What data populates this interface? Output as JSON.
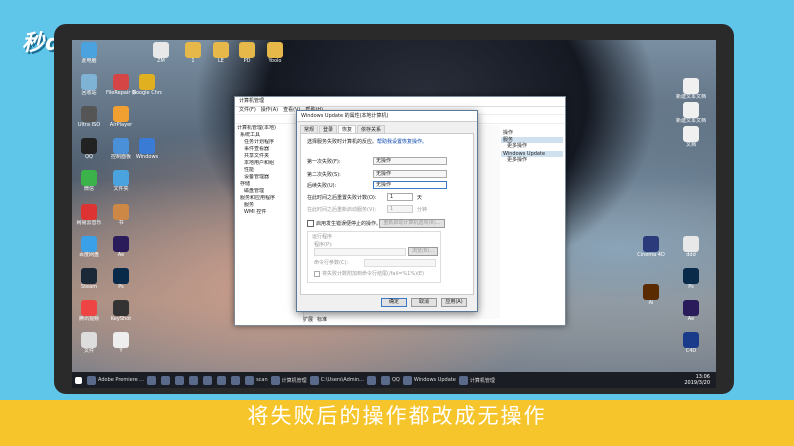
{
  "brand": "秒dòng视频",
  "caption": "将失败后的操作都改成无操作",
  "desktop_icons": [
    {
      "label": "此电脑",
      "color": "#4aa3df"
    },
    {
      "label": "ZM",
      "color": "#e8e8e8"
    },
    {
      "label": "1",
      "color": "#e6b84a"
    },
    {
      "label": "LE",
      "color": "#e6b84a"
    },
    {
      "label": "PD",
      "color": "#e6b84a"
    },
    {
      "label": "Yoolo",
      "color": "#e6b84a"
    },
    {
      "label": "回收站",
      "color": "#7fb3d5"
    },
    {
      "label": "FileRepair 数据恢复",
      "color": "#d64545"
    },
    {
      "label": "Google Chrome",
      "color": "#e0b020"
    },
    {
      "label": "Ultra ISO",
      "color": "#555"
    },
    {
      "label": "AirPlayer",
      "color": "#f0a030"
    },
    {
      "label": "QQ",
      "color": "#222"
    },
    {
      "label": "控制面板",
      "color": "#4a90d9"
    },
    {
      "label": "Windows",
      "color": "#3a7bd5"
    },
    {
      "label": "微信",
      "color": "#3cb34a"
    },
    {
      "label": "文件夹",
      "color": "#4aa3df"
    },
    {
      "label": "网易云音乐",
      "color": "#d33"
    },
    {
      "label": "书",
      "color": "#c84"
    },
    {
      "label": "百度网盘",
      "color": "#3aa0e8"
    },
    {
      "label": "Ae",
      "color": "#2a1b5a"
    },
    {
      "label": "Steam",
      "color": "#1b2838"
    },
    {
      "label": "Ps",
      "color": "#0a2a4a"
    },
    {
      "label": "腾讯视频",
      "color": "#e44"
    },
    {
      "label": "KeyShot",
      "color": "#333"
    },
    {
      "label": "文件",
      "color": "#ddd"
    },
    {
      "label": "Y",
      "color": "#eee"
    }
  ],
  "right_icons": [
    {
      "label": "新建文本文档",
      "color": "#f0f0f0"
    },
    {
      "label": "新建文本文档(2)",
      "color": "#f0f0f0"
    },
    {
      "label": "文档",
      "color": "#f0f0f0"
    },
    {
      "label": "Cinema 4D",
      "color": "#2a3a7a"
    },
    {
      "label": "ddd",
      "color": "#e8e8e8"
    },
    {
      "label": "Ps",
      "color": "#0a2a4a"
    },
    {
      "label": "Ai",
      "color": "#5a2a00"
    },
    {
      "label": "Ae",
      "color": "#2a1b5a"
    },
    {
      "label": "C4D",
      "color": "#1a3a8a"
    }
  ],
  "taskbar": {
    "items": [
      "Adobe Premiere ...",
      "",
      "",
      "",
      "",
      "",
      "",
      "",
      "scan",
      "计算机管理",
      "C:\\Users\\Admin...",
      "",
      "QQ",
      "Windows Update",
      "计算机管理"
    ],
    "time": "13:06",
    "date": "2019/3/20"
  },
  "mmc": {
    "title": "计算机管理",
    "menu": [
      "文件(F)",
      "操作(A)",
      "查看(V)",
      "帮助(H)"
    ],
    "tree": [
      "计算机管理(本地)",
      "系统工具",
      "任务计划程序",
      "事件查看器",
      "共享文件夹",
      "本地用户和组",
      "性能",
      "设备管理器",
      "存储",
      "磁盘管理",
      "服务和应用程序",
      "服务",
      "WMI 控件"
    ],
    "actions_header": "操作",
    "action_groups": [
      {
        "header": "服务",
        "items": [
          "更多操作"
        ]
      },
      {
        "header": "Windows Update",
        "items": [
          "更多操作"
        ]
      }
    ],
    "status_tabs": [
      "扩展",
      "标准"
    ]
  },
  "props": {
    "title": "Windows Update 的属性(本地计算机)",
    "tabs": [
      "常规",
      "登录",
      "恢复",
      "依存关系"
    ],
    "intro": "选择服务失败时计算机的反应。",
    "intro_link": "帮助我设置恢复操作。",
    "first_failure_label": "第一次失败(F):",
    "first_failure_value": "无操作",
    "second_failure_label": "第二次失败(S):",
    "second_failure_value": "无操作",
    "subsequent_label": "后续失败(U):",
    "subsequent_value": "无操作",
    "reset_label": "在此时间之后重置失败计数(O):",
    "reset_value": "1",
    "reset_unit": "天",
    "restart_label": "在此时间之后重新启动服务(V):",
    "restart_value": "1",
    "restart_unit": "分钟",
    "enable_actions": "启用发生错误便停止的操作。",
    "restart_options_btn": "重新启动计算机选项(R)...",
    "run_program_group": "运行程序",
    "program_label": "程序(P):",
    "browse_btn": "浏览(B)...",
    "params_label": "命令行参数(C):",
    "append_fail": "将失败计数附加到命令行结尾(/fail=%1%)(E)",
    "ok": "确定",
    "cancel": "取消",
    "apply": "应用(A)"
  }
}
